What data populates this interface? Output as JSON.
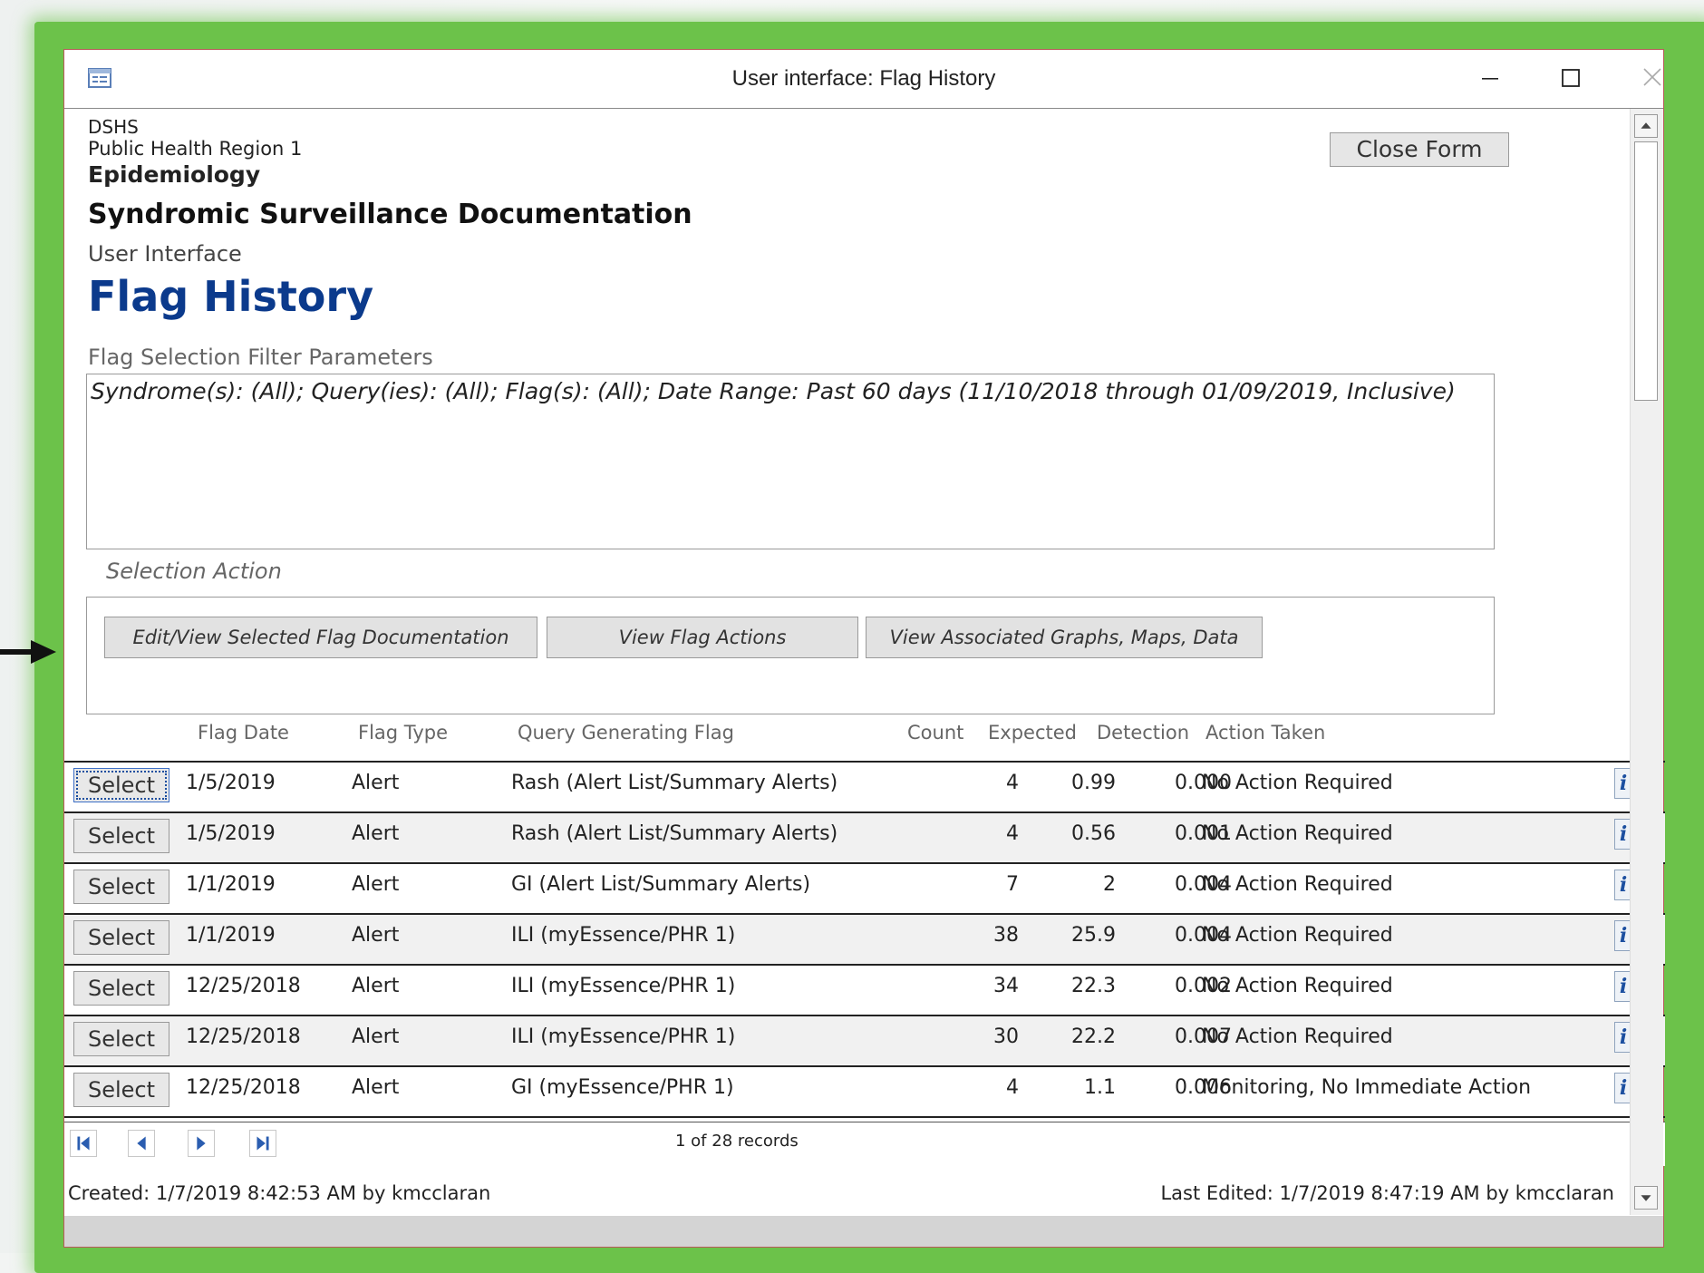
{
  "window": {
    "title": "User interface: Flag History"
  },
  "header": {
    "org": "DSHS",
    "region": "Public Health Region 1",
    "dept": "Epidemiology",
    "doc_title": "Syndromic Surveillance Documentation",
    "section": "User Interface",
    "page_title": "Flag History"
  },
  "close_button": {
    "label": "Close Form"
  },
  "filter": {
    "label": "Flag Selection Filter Parameters",
    "value": "Syndrome(s): (All); Query(ies): (All); Flag(s): (All); Date Range: Past  60 days (11/10/2018 through 01/09/2019, Inclusive)"
  },
  "selection_action": {
    "legend": "Selection Action",
    "buttons": [
      {
        "label": "Edit/View Selected Flag Documentation"
      },
      {
        "label": "View Flag Actions"
      },
      {
        "label": "View Associated Graphs, Maps, Data"
      }
    ]
  },
  "table": {
    "headers": {
      "flag_date": "Flag Date",
      "flag_type": "Flag Type",
      "query": "Query Generating Flag",
      "count": "Count",
      "expected": "Expected",
      "detection": "Detection",
      "action": "Action Taken"
    },
    "select_label": "Select",
    "info_label": "i",
    "rows": [
      {
        "date": "1/5/2019",
        "type": "Alert",
        "query": "Rash (Alert List/Summary Alerts)",
        "count": "4",
        "expected": "0.99",
        "detection": "0.000",
        "action": "No Action Required"
      },
      {
        "date": "1/5/2019",
        "type": "Alert",
        "query": "Rash (Alert List/Summary Alerts)",
        "count": "4",
        "expected": "0.56",
        "detection": "0.001",
        "action": "No Action Required"
      },
      {
        "date": "1/1/2019",
        "type": "Alert",
        "query": "GI (Alert List/Summary Alerts)",
        "count": "7",
        "expected": "2",
        "detection": "0.004",
        "action": "No Action Required"
      },
      {
        "date": "1/1/2019",
        "type": "Alert",
        "query": "ILI (myEssence/PHR 1)",
        "count": "38",
        "expected": "25.9",
        "detection": "0.004",
        "action": "No Action Required"
      },
      {
        "date": "12/25/2018",
        "type": "Alert",
        "query": "ILI (myEssence/PHR 1)",
        "count": "34",
        "expected": "22.3",
        "detection": "0.002",
        "action": "No Action Required"
      },
      {
        "date": "12/25/2018",
        "type": "Alert",
        "query": "ILI (myEssence/PHR 1)",
        "count": "30",
        "expected": "22.2",
        "detection": "0.007",
        "action": "No Action Required"
      },
      {
        "date": "12/25/2018",
        "type": "Alert",
        "query": "GI (myEssence/PHR 1)",
        "count": "4",
        "expected": "1.1",
        "detection": "0.006",
        "action": "Monitoring, No Immediate Action"
      }
    ]
  },
  "navigation": {
    "record_count": "1 of 28 records"
  },
  "footer": {
    "created": "Created: 1/7/2019 8:42:53 AM by kmcclaran",
    "edited": "Last Edited: 1/7/2019 8:47:19 AM by kmcclaran"
  },
  "icons": {
    "form": "form-icon",
    "minimize": "minimize-icon",
    "maximize": "maximize-icon",
    "close": "close-icon",
    "first": "first-record-icon",
    "prev": "previous-record-icon",
    "next": "next-record-icon",
    "last": "last-record-icon"
  },
  "colors": {
    "frame_green": "#6cc24a",
    "title_blue": "#0b3a8c",
    "info_blue": "#1c4fa0"
  }
}
